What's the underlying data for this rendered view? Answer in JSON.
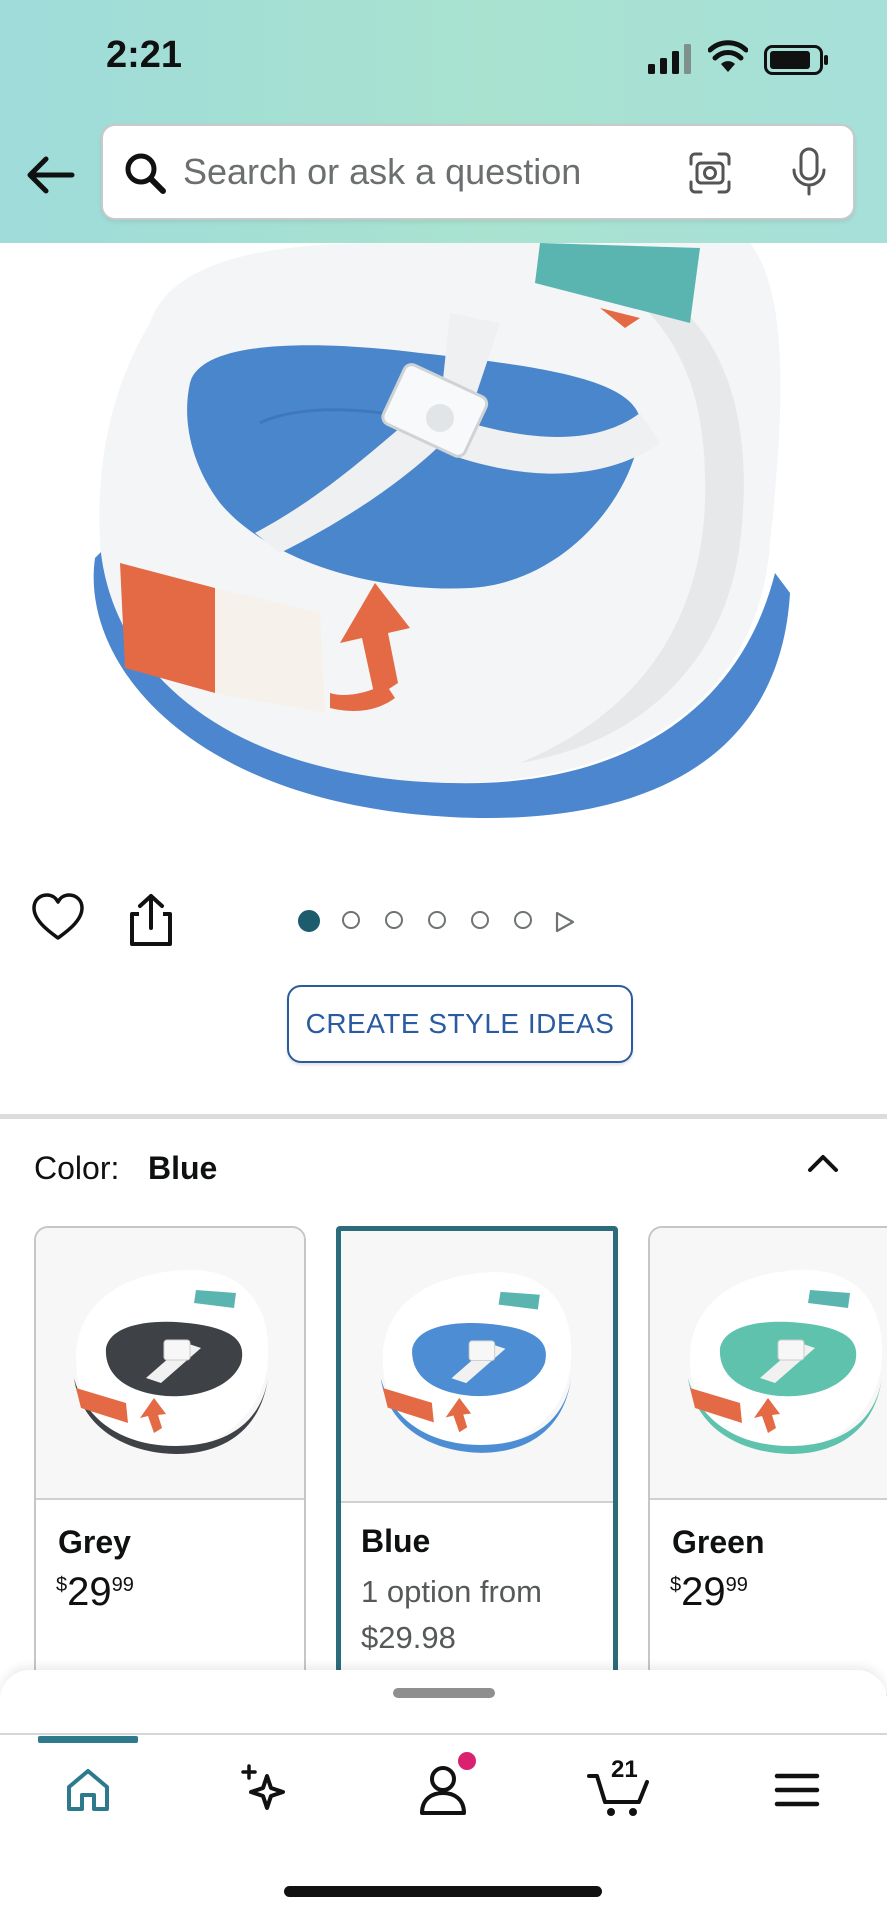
{
  "status_bar": {
    "time": "2:21"
  },
  "search": {
    "placeholder": "Search or ask a question"
  },
  "product": {
    "style_button_label": "CREATE STYLE IDEAS",
    "image_dots": {
      "total": 6,
      "active_index": 0
    }
  },
  "color": {
    "label": "Color:",
    "selected": "Blue",
    "options": [
      {
        "name": "Grey",
        "price_symbol": "$",
        "price_whole": "29",
        "price_fraction": "99",
        "accent": "#3e4246"
      },
      {
        "name": "Blue",
        "description": "1 option from $29.98",
        "accent": "#4c8dd3"
      },
      {
        "name": "Green",
        "price_symbol": "$",
        "price_whole": "29",
        "price_fraction": "99",
        "accent": "#5fc2ad"
      }
    ]
  },
  "bottom_nav": {
    "cart_count": "21",
    "active_tab": "home",
    "accent": "#2c7a8c",
    "notification_color": "#d9216f"
  }
}
